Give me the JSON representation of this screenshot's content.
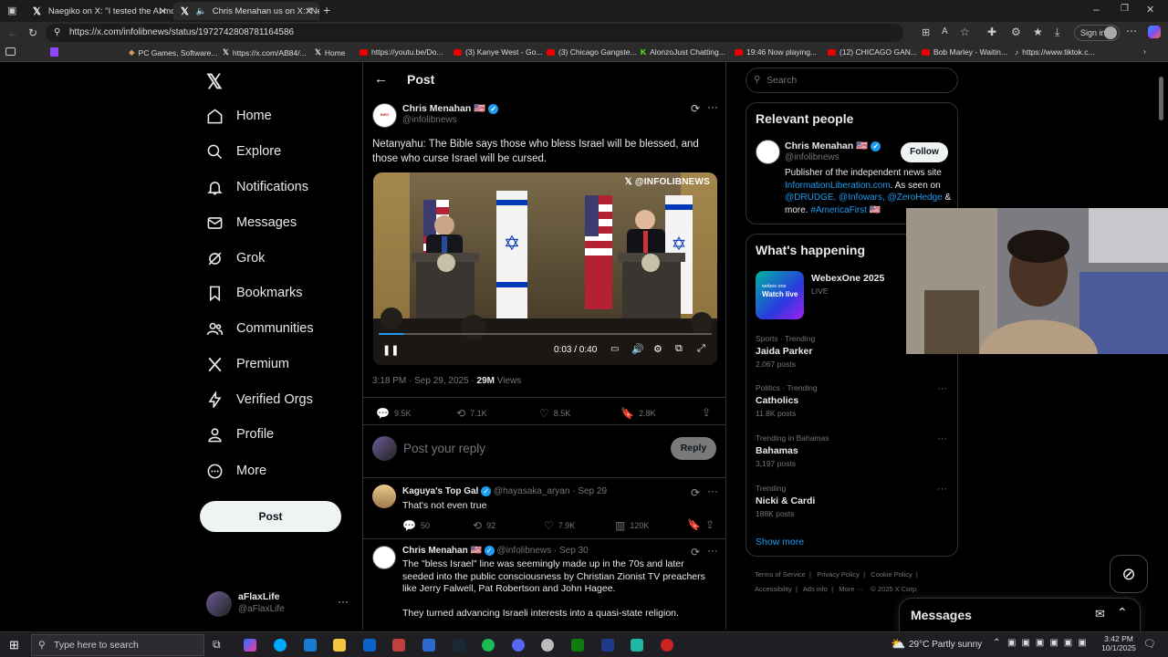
{
  "browser": {
    "tabs": [
      {
        "title": "Naegiko on X: \"I tested the AI mo",
        "active": false
      },
      {
        "title": "Chris Menahan us on X: \"Ne",
        "active": true
      }
    ],
    "url": "https://x.com/infolibnews/status/1972742808781164586",
    "sign_in": "Sign in",
    "bookmarks": [
      "PC Games, Software...",
      "https://x.com/AB84/...",
      "Home",
      "https://youtu.be/Do...",
      "(3) Kanye West - Go...",
      "(3) Chicago Gangste...",
      "AlonzoJust Chatting...",
      "19:46 Now playing...",
      "(12) CHICAGO GAN...",
      "Bob Marley - Waitin...",
      "https://www.tiktok.c..."
    ]
  },
  "nav": {
    "items": [
      "Home",
      "Explore",
      "Notifications",
      "Messages",
      "Grok",
      "Bookmarks",
      "Communities",
      "Premium",
      "Verified Orgs",
      "Profile",
      "More"
    ],
    "post_button": "Post",
    "account_name": "aFlaxLife",
    "account_handle": "@aFlaxLife"
  },
  "main": {
    "header": "Post",
    "post": {
      "author": "Chris Menahan 🇺🇸",
      "handle": "@infolibnews",
      "text": "Netanyahu: The Bible says those who bless Israel will be blessed, and those who curse Israel will be cursed.",
      "video_watermark": "@INFOLIBNEWS",
      "video_time": "0:03 / 0:40",
      "video_progress": 0.075,
      "timestamp": "3:18 PM · Sep 29, 2025 · ",
      "views_count": "29M",
      "views_label": " Views",
      "replies": "9.5K",
      "reposts": "7.1K",
      "likes": "8.5K",
      "bookmarks": "2.8K"
    },
    "reply_placeholder": "Post your reply",
    "reply_button": "Reply",
    "replies": [
      {
        "author": "Kaguya's Top Gal",
        "handle": "@hayasaka_aryan · Sep 29",
        "text": "That's not even true",
        "replies": "50",
        "reposts": "92",
        "likes": "7.9K",
        "views": "120K"
      },
      {
        "author": "Chris Menahan 🇺🇸",
        "handle": "@infolibnews · Sep 30",
        "text": "The \"bless Israel\" line was seemingly made up in the 70s and later seeded into the public consciousness by Christian Zionist TV preachers like Jerry Falwell, Pat Robertson and John Hagee.",
        "text2": "They turned advancing Israeli interests into a quasi-state religion."
      }
    ]
  },
  "sidebar": {
    "search_placeholder": "Search",
    "relevant_title": "Relevant people",
    "person_name": "Chris Menahan 🇺🇸",
    "person_handle": "@infolibnews",
    "follow_label": "Follow",
    "bio_1": "Publisher of the independent news site",
    "bio_link": "InformationLiberation.com",
    "bio_2": ". As seen on",
    "bio_mentions": "@DRUDGE, @Infowars, @ZeroHedge",
    "bio_amp": " &",
    "bio_more": "more.",
    "bio_hashtag": "#AmericaFirst",
    "bio_flag": " 🇺🇸",
    "happening_title": "What's happening",
    "event_name": "WebexOne 2025",
    "event_status": "LIVE",
    "event_thumb_brand": "webex one",
    "event_thumb_label": "Watch live",
    "trends": [
      {
        "category": "Sports · Trending",
        "name": "Jaida Parker",
        "count": "2,067 posts"
      },
      {
        "category": "Politics · Trending",
        "name": "Catholics",
        "count": "11.8K posts"
      },
      {
        "category": "Trending in Bahamas",
        "name": "Bahamas",
        "count": "3,197 posts"
      },
      {
        "category": "Trending",
        "name": "Nicki & Cardi",
        "count": "188K posts"
      }
    ],
    "show_more": "Show more",
    "footer_row1": [
      "Terms of Service",
      "Privacy Policy",
      "Cookie Policy"
    ],
    "footer_row2": [
      "Accessibility",
      "Ads info",
      "More ···",
      "© 2025 X Corp."
    ],
    "messages_label": "Messages"
  },
  "taskbar": {
    "search_placeholder": "Type here to search",
    "weather": "29°C  Partly sunny",
    "time": "3:42 PM",
    "date": "10/1/2025"
  }
}
